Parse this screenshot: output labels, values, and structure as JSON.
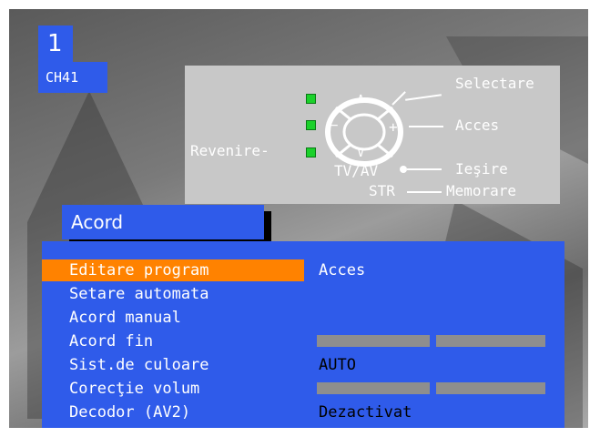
{
  "osd": {
    "program_number": "1",
    "channel": "CH41"
  },
  "help": {
    "selectare": "Selectare",
    "acces": "Acces",
    "revenire": "Revenire-",
    "tvav": "TV/AV",
    "iesire": "Ieşire",
    "str": "STR",
    "memorare": "Memorare",
    "arrow_up": "∧",
    "arrow_down": "∨",
    "minus": "−",
    "plus": "+"
  },
  "menu": {
    "title": "Acord",
    "items": [
      {
        "label": "Editare program",
        "selected": true
      },
      {
        "label": "Setare automata",
        "selected": false
      },
      {
        "label": "Acord manual",
        "selected": false
      },
      {
        "label": "Acord fin",
        "selected": false
      },
      {
        "label": "Sist.de culoare",
        "selected": false
      },
      {
        "label": "Corecţie volum",
        "selected": false
      },
      {
        "label": "Decodor (AV2)",
        "selected": false
      }
    ],
    "values": {
      "editare_program": "Acces",
      "sist_culoare": "AUTO",
      "decodor": "Dezactivat"
    }
  },
  "colors": {
    "menu_blue": "#2f5bea",
    "selection_orange": "#ff8200",
    "led_green": "#1bd12b",
    "help_panel_gray": "#c8c8c8"
  }
}
